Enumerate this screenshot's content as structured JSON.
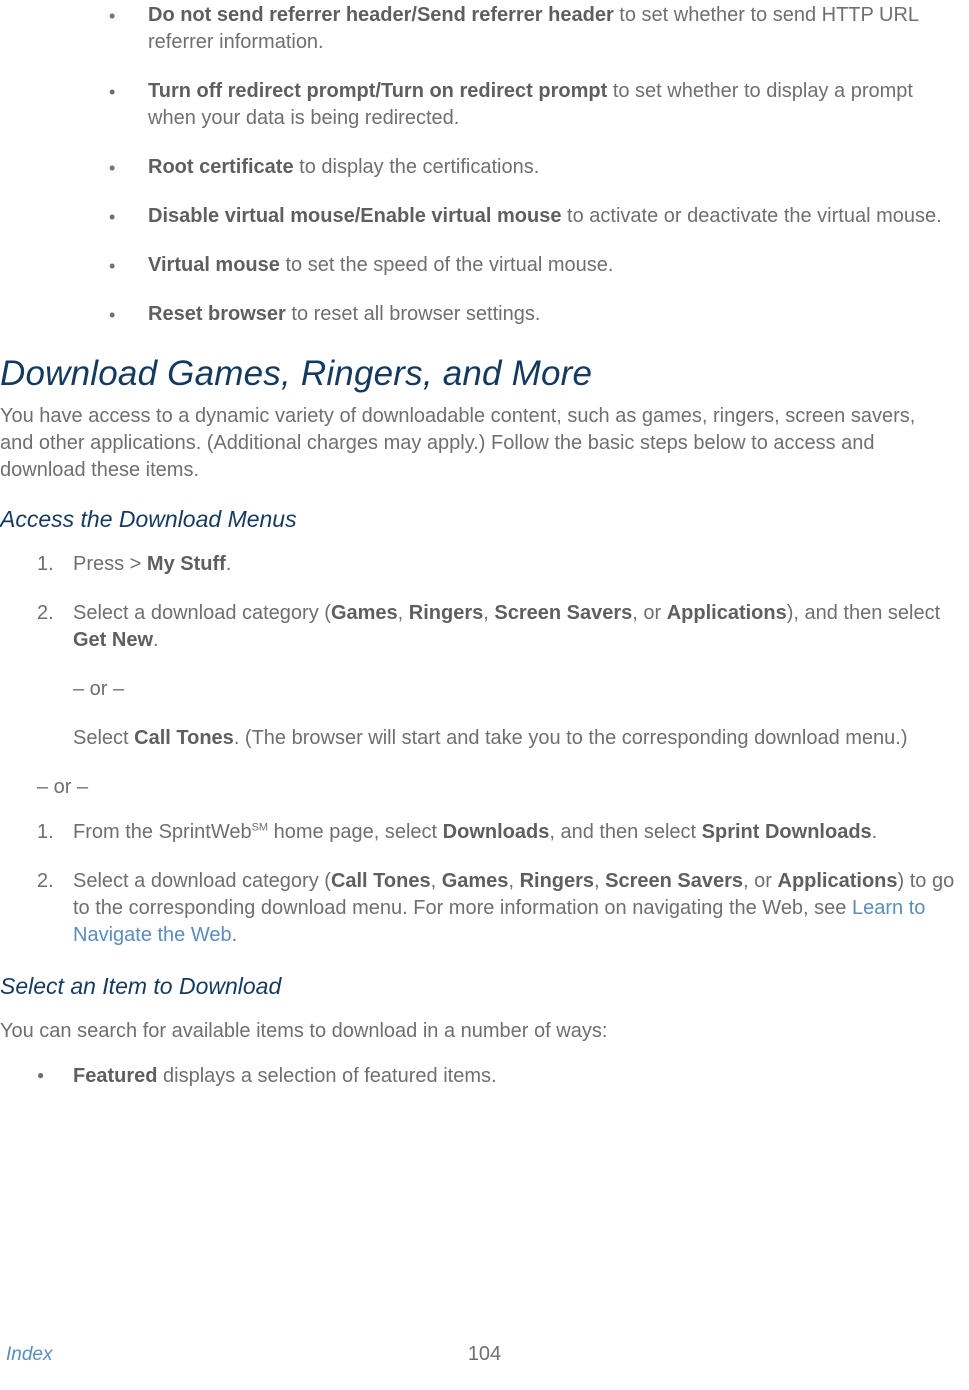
{
  "bullets_top": [
    {
      "bold": "Do not send referrer header/Send referrer header",
      "rest": " to set whether to send HTTP URL referrer information."
    },
    {
      "bold": "Turn off redirect prompt/Turn on redirect prompt",
      "rest": " to set whether to display a prompt when your data is being redirected."
    },
    {
      "bold": "Root certificate",
      "rest": " to display the certifications."
    },
    {
      "bold": "Disable virtual mouse/Enable virtual mouse",
      "rest": " to activate or deactivate the virtual mouse."
    },
    {
      "bold": "Virtual mouse",
      "rest": " to set the speed of the virtual mouse."
    },
    {
      "bold": "Reset browser",
      "rest": " to reset all browser settings."
    }
  ],
  "heading1": "Download Games, Ringers, and More",
  "intro": "You have access to a dynamic variety of downloadable content, such as games, ringers, screen savers, and other applications. (Additional charges may apply.) Follow the basic steps below to access and download these items.",
  "sub1": "Access the Download Menus",
  "list_a": {
    "item1_prefix": "Press  > ",
    "item1_bold": "My Stuff",
    "item1_suffix": ".",
    "item2_prefix": "Select a download category (",
    "item2_b1": "Games",
    "item2_s1": ", ",
    "item2_b2": "Ringers",
    "item2_s2": ", ",
    "item2_b3": "Screen Savers",
    "item2_s3": ", or ",
    "item2_b4": "Applications",
    "item2_s4": "), and then select ",
    "item2_b5": "Get New",
    "item2_s5": ".",
    "or": "– or –",
    "item2b_prefix": "Select ",
    "item2b_bold": "Call Tones",
    "item2b_suffix": ". (The browser will start and take you to the corresponding download menu.)"
  },
  "or_outer": "– or –",
  "list_b": {
    "item1_prefix": "From the SprintWeb",
    "item1_sup": "SM",
    "item1_mid": " home page, select ",
    "item1_b1": "Downloads",
    "item1_s1": ", and then select ",
    "item1_b2": "Sprint Downloads",
    "item1_s2": ".",
    "item2_prefix": "Select a download category (",
    "item2_b1": "Call Tones",
    "item2_s1": ", ",
    "item2_b2": "Games",
    "item2_s2": ", ",
    "item2_b3": "Ringers",
    "item2_s3": ", ",
    "item2_b4": "Screen Savers",
    "item2_s4": ", or ",
    "item2_b5": "Applications",
    "item2_s5": ") to go to the corresponding download menu. For more information on navigating the Web, see ",
    "item2_link": "Learn to Navigate the Web",
    "item2_s6": "."
  },
  "sub2": "Select an Item to Download",
  "para2": "You can search for available items to download in a number of ways:",
  "bullets_bottom": {
    "b1_bold": "Featured",
    "b1_rest": " displays a selection of featured items."
  },
  "footer": {
    "index": "Index",
    "page": "104"
  }
}
